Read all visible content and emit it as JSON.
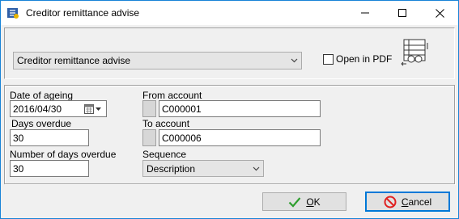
{
  "window": {
    "title": "Creditor remittance advise"
  },
  "report": {
    "selected": "Creditor remittance advise"
  },
  "open_in_pdf": {
    "label": "Open in PDF",
    "checked": false
  },
  "fields": {
    "date_of_ageing": {
      "label": "Date of ageing",
      "value": "2016/04/30"
    },
    "days_overdue": {
      "label": "Days overdue",
      "value": "30"
    },
    "number_of_days_overdue": {
      "label": "Number of days overdue",
      "value": "30"
    },
    "from_account": {
      "label": "From account",
      "value": "C000001"
    },
    "to_account": {
      "label": "To account",
      "value": "C000006"
    },
    "sequence": {
      "label": "Sequence",
      "value": "Description"
    }
  },
  "buttons": {
    "ok_mnemonic": "O",
    "ok_rest": "K",
    "cancel_mnemonic": "C",
    "cancel_rest": "ancel"
  },
  "colors": {
    "ok_check": "#2e9e2e",
    "cancel_icon": "#e02020",
    "focus_border": "#0078d7"
  }
}
